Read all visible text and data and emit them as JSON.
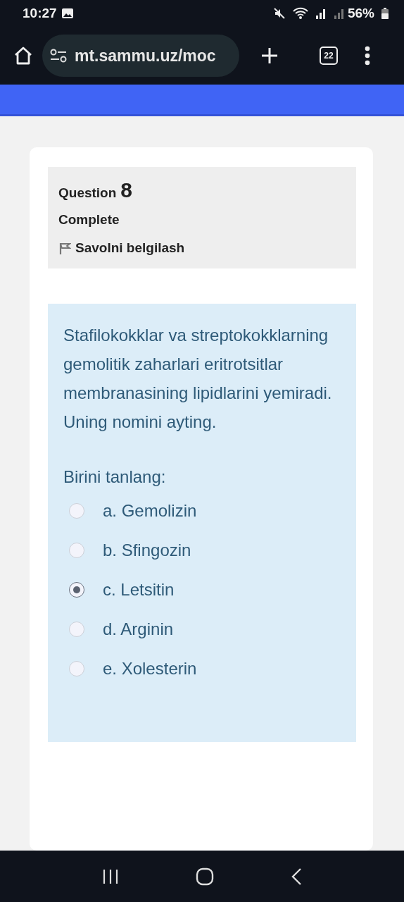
{
  "status_bar": {
    "time": "10:27",
    "battery": "56%"
  },
  "browser": {
    "url": "mt.sammu.uz/moc",
    "tab_count": "22"
  },
  "question": {
    "label": "Question",
    "number": "8",
    "state": "Complete",
    "flag_label": "Savolni belgilash",
    "text": "Stafilokokklar va streptokokklarning gemolitik zaharlari eritrotsitlar membranasining lipidlarini yemiradi. Uning nomini ayting.",
    "prompt": "Birini tanlang:",
    "options": [
      {
        "label": "a. Gemolizin",
        "selected": false
      },
      {
        "label": "b. Sfingozin",
        "selected": false
      },
      {
        "label": "c. Letsitin",
        "selected": true
      },
      {
        "label": "d. Arginin",
        "selected": false
      },
      {
        "label": "e. Xolesterin",
        "selected": false
      }
    ]
  }
}
